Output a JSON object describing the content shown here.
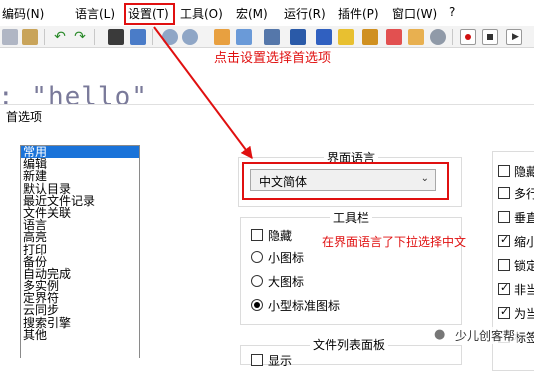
{
  "menu": [
    "编码(N)",
    "语言(L)",
    "设置(T)",
    "工具(O)",
    "宏(M)",
    "运行(R)",
    "插件(P)",
    "窗口(W)",
    "?"
  ],
  "editor": {
    "code_text": ": \"hello\""
  },
  "annotations": {
    "click_settings": "点击设置选择首选项",
    "choose_chinese": "在界面语言了下拉选择中文"
  },
  "dialog": {
    "title": "首选项",
    "categories": [
      "常用",
      "编辑",
      "新建",
      "默认目录",
      "最近文件记录",
      "文件关联",
      "语言",
      "高亮",
      "打印",
      "备份",
      "自动完成",
      "多实例",
      "定界符",
      "云同步",
      "搜索引擎",
      "其他"
    ],
    "ui_language": {
      "title": "界面语言",
      "selected": "中文简体"
    },
    "toolbar_group": {
      "title": "工具栏",
      "hide_label": "隐藏",
      "small_icon": "小图标",
      "large_icon": "大图标",
      "small_standard_icon": "小型标准图标"
    },
    "file_list_group": {
      "title": "文件列表面板",
      "show_label": "显示"
    },
    "right_options": [
      "隐藏",
      "多行",
      "垂直",
      "缩小",
      "锁定",
      "非当",
      "为当",
      "标签"
    ]
  },
  "watermark": "少儿创客帮",
  "colors": {
    "annotation": "#e01010",
    "selection": "#1a73d9"
  }
}
